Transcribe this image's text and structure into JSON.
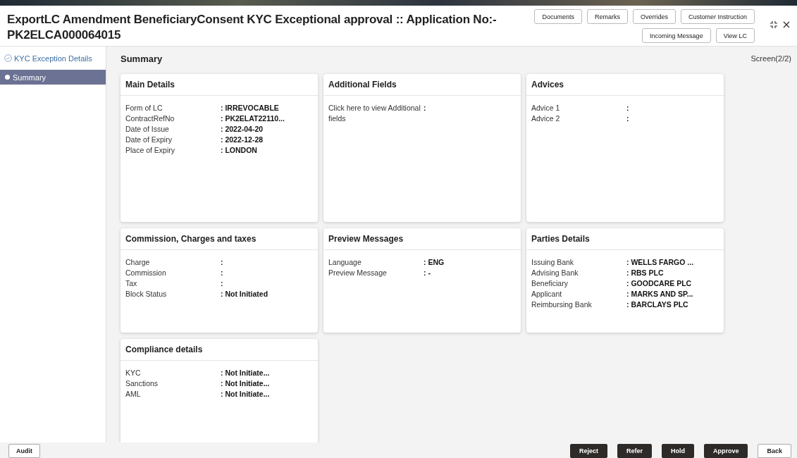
{
  "header": {
    "title": "ExportLC Amendment BeneficiaryConsent KYC Exceptional approval :: Application No:-",
    "subtitle": "PK2ELCA000064015",
    "buttons_row_1": [
      "Documents",
      "Remarks",
      "Overrides",
      "Customer Instruction"
    ],
    "buttons_row_2": [
      "Incoming Message",
      "View LC"
    ]
  },
  "sidebar": {
    "items": [
      {
        "label": "KYC Exception Details",
        "selected": false
      },
      {
        "label": "Summary",
        "selected": true
      }
    ]
  },
  "summary": {
    "title": "Summary",
    "screen": "Screen(2/2)",
    "cards": [
      {
        "title": "Main Details",
        "fields": [
          {
            "label": "Form of LC",
            "value": ": IRREVOCABLE"
          },
          {
            "label": "ContractRefNo",
            "value": ": PK2ELAT22110..."
          },
          {
            "label": "Date of Issue",
            "value": ": 2022-04-20"
          },
          {
            "label": "Date of Expiry",
            "value": ": 2022-12-28"
          },
          {
            "label": "Place of Expiry",
            "value": ": LONDON"
          }
        ]
      },
      {
        "title": "Additional Fields",
        "fields": [
          {
            "label": "Click here to view Additional fields",
            "value": ":"
          }
        ]
      },
      {
        "title": "Advices",
        "fields": [
          {
            "label": "Advice 1",
            "value": ":"
          },
          {
            "label": "Advice 2",
            "value": ":"
          }
        ]
      },
      {
        "title": "Commission, Charges and taxes",
        "fields": [
          {
            "label": "Charge",
            "value": ":"
          },
          {
            "label": "Commission",
            "value": ":"
          },
          {
            "label": "Tax",
            "value": ":"
          },
          {
            "label": "Block Status",
            "value": ": Not Initiated"
          }
        ]
      },
      {
        "title": "Preview Messages",
        "fields": [
          {
            "label": "Language",
            "value": ": ENG"
          },
          {
            "label": "Preview Message",
            "value": ": -"
          }
        ]
      },
      {
        "title": "Parties Details",
        "fields": [
          {
            "label": "Issuing Bank",
            "value": ": WELLS FARGO ..."
          },
          {
            "label": "Advising Bank",
            "value": ": RBS PLC"
          },
          {
            "label": "Beneficiary",
            "value": ": GOODCARE PLC"
          },
          {
            "label": "Applicant",
            "value": ": MARKS AND SP..."
          },
          {
            "label": "Reimbursing Bank",
            "value": ": BARCLAYS PLC"
          }
        ]
      },
      {
        "title": "Compliance details",
        "fields": [
          {
            "label": "KYC",
            "value": ": Not Initiate..."
          },
          {
            "label": "Sanctions",
            "value": ": Not Initiate..."
          },
          {
            "label": "AML",
            "value": ": Not Initiate..."
          }
        ]
      }
    ]
  },
  "footer": {
    "left_button": "Audit",
    "buttons": [
      {
        "label": "Reject",
        "kind": "primary"
      },
      {
        "label": "Refer",
        "kind": "primary"
      },
      {
        "label": "Hold",
        "kind": "primary"
      },
      {
        "label": "Approve",
        "kind": "primary"
      },
      {
        "label": "Back",
        "kind": "secondary"
      }
    ]
  }
}
